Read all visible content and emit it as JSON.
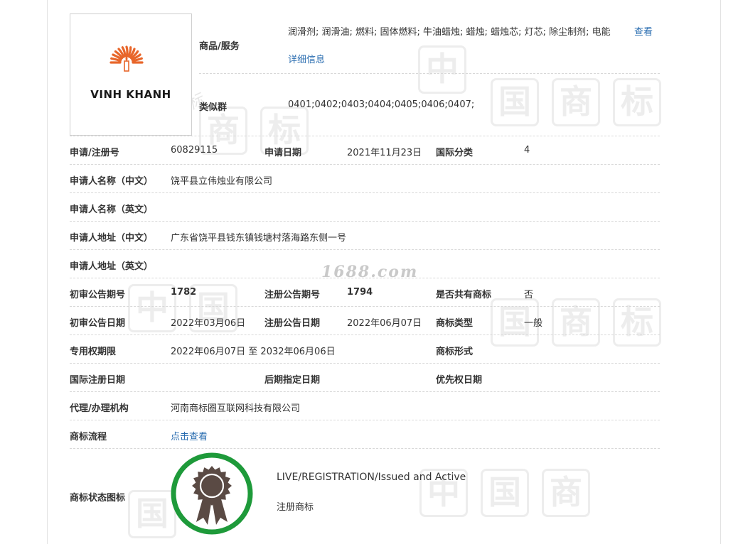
{
  "logo": {
    "brand_text": "VINH KHANH"
  },
  "goods": {
    "label": "商品/服务",
    "value": "润滑剂; 润滑油; 燃料; 固体燃料; 牛油蜡烛; 蜡烛; 蜡烛芯; 灯芯; 除尘制剂; 电能",
    "more_link": "查看详细信息"
  },
  "similar_group": {
    "label": "类似群",
    "value": "0401;0402;0403;0404;0405;0406;0407;"
  },
  "reg_no": {
    "label": "申请/注册号",
    "value": "60829115"
  },
  "apply_date": {
    "label": "申请日期",
    "value": "2021年11月23日"
  },
  "intl_class": {
    "label": "国际分类",
    "value": "4"
  },
  "applicant_cn": {
    "label": "申请人名称（中文）",
    "value": "饶平县立伟烛业有限公司"
  },
  "applicant_en": {
    "label": "申请人名称（英文）",
    "value": ""
  },
  "address_cn": {
    "label": "申请人地址（中文）",
    "value": "广东省饶平县钱东镇钱塘村落海路东侧一号"
  },
  "address_en": {
    "label": "申请人地址（英文）",
    "value": ""
  },
  "prelim_no": {
    "label": "初审公告期号",
    "value": "1782"
  },
  "reg_pub_no": {
    "label": "注册公告期号",
    "value": "1794"
  },
  "shared": {
    "label": "是否共有商标",
    "value": "否"
  },
  "prelim_date": {
    "label": "初审公告日期",
    "value": "2022年03月06日"
  },
  "reg_pub_date": {
    "label": "注册公告日期",
    "value": "2022年06月07日"
  },
  "tm_type": {
    "label": "商标类型",
    "value": "一般"
  },
  "exclusive_period": {
    "label": "专用权期限",
    "value": "2022年06月07日 至 2032年06月06日"
  },
  "tm_form": {
    "label": "商标形式",
    "value": ""
  },
  "intl_reg_date": {
    "label": "国际注册日期",
    "value": ""
  },
  "later_designation_date": {
    "label": "后期指定日期",
    "value": ""
  },
  "priority_date": {
    "label": "优先权日期",
    "value": ""
  },
  "agent": {
    "label": "代理/办理机构",
    "value": "河南商标圈互联网科技有限公司"
  },
  "process": {
    "label": "商标流程",
    "link": "点击查看"
  },
  "status": {
    "label": "商标状态图标",
    "en": "LIVE/REGISTRATION/Issued and Active",
    "cn": "注册商标"
  },
  "watermark": {
    "site": "1688.com",
    "cn_small": "中国商标",
    "chars": [
      "中",
      "国",
      "商",
      "标"
    ]
  },
  "colors": {
    "link": "#2a6db0",
    "badge_ring": "#1e9a3a",
    "badge_icon": "#5a4a44",
    "logo_orange": "#e8662a"
  }
}
